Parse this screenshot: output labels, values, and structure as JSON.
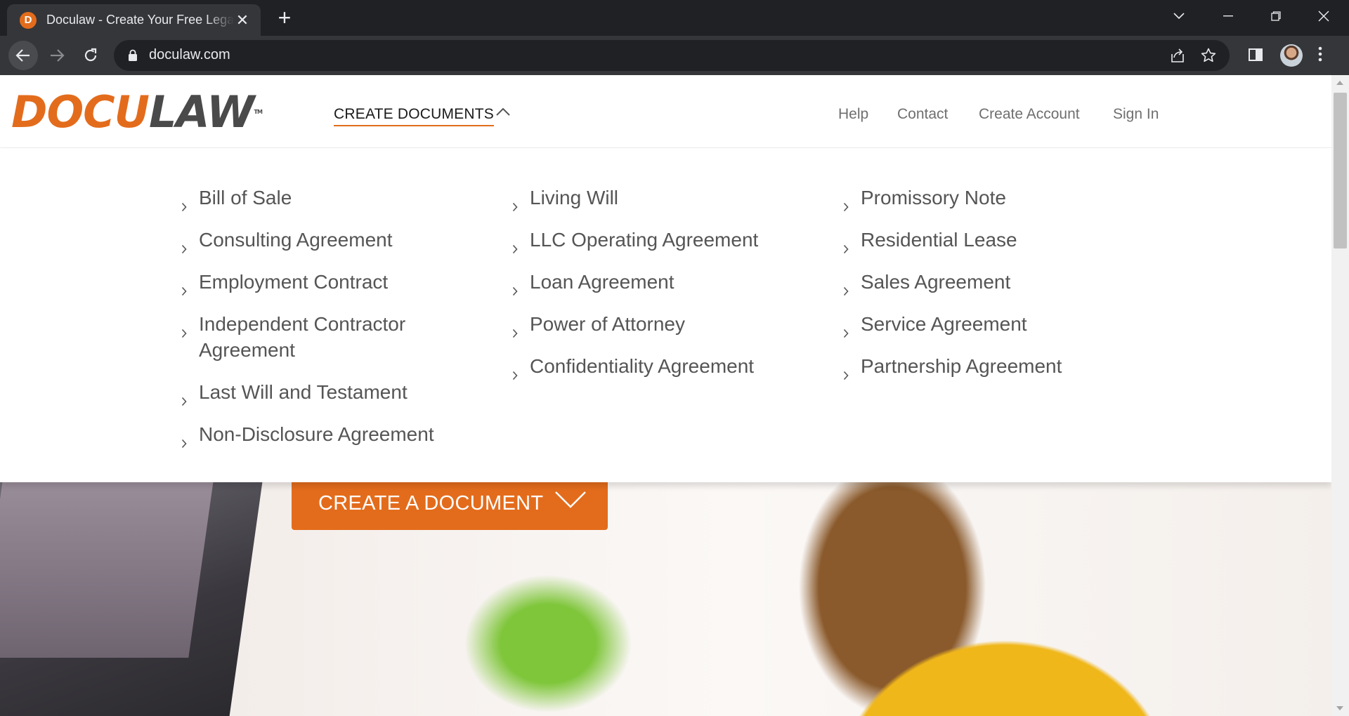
{
  "browser": {
    "tab_title": "Doculaw - Create Your Free Legal Documents",
    "favicon_letter": "D",
    "url": "doculaw.com",
    "new_tab_label": "+",
    "tab_close_label": "✕"
  },
  "header": {
    "logo_docu": "DOCU",
    "logo_law": "LAW",
    "logo_tm": "TM",
    "create_documents": "CREATE DOCUMENTS",
    "nav": {
      "help": "Help",
      "contact": "Contact",
      "create_account": "Create Account",
      "sign_in": "Sign In"
    }
  },
  "menu": {
    "col1": [
      "Bill of Sale",
      "Consulting Agreement",
      "Employment Contract",
      "Independent Contractor Agreement",
      "Last Will and Testament",
      "Non-Disclosure Agreement"
    ],
    "col2": [
      "Living Will",
      "LLC Operating Agreement",
      "Loan Agreement",
      "Power of Attorney",
      "Confidentiality Agreement"
    ],
    "col3": [
      "Promissory Note",
      "Residential Lease",
      "Sales Agreement",
      "Service Agreement",
      "Partnership Agreement"
    ]
  },
  "hero": {
    "cta_label": "CREATE A DOCUMENT"
  },
  "colors": {
    "brand_orange": "#e36c1c",
    "brand_gray": "#4a4a4a",
    "chrome_dark": "#202124"
  }
}
